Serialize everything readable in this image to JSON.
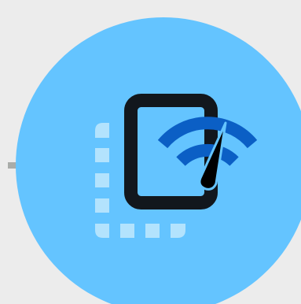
{
  "icon": {
    "name": "network-speed-monitor-icon",
    "colors": {
      "background": "#ececec",
      "circle": "#64c4ff",
      "device_frame": "#12171d",
      "dotted_outline": "#b3e3fd",
      "signal_arcs": "#0b5fc5",
      "gauge_needle": "#000000",
      "connector": "#a9aca9"
    }
  }
}
